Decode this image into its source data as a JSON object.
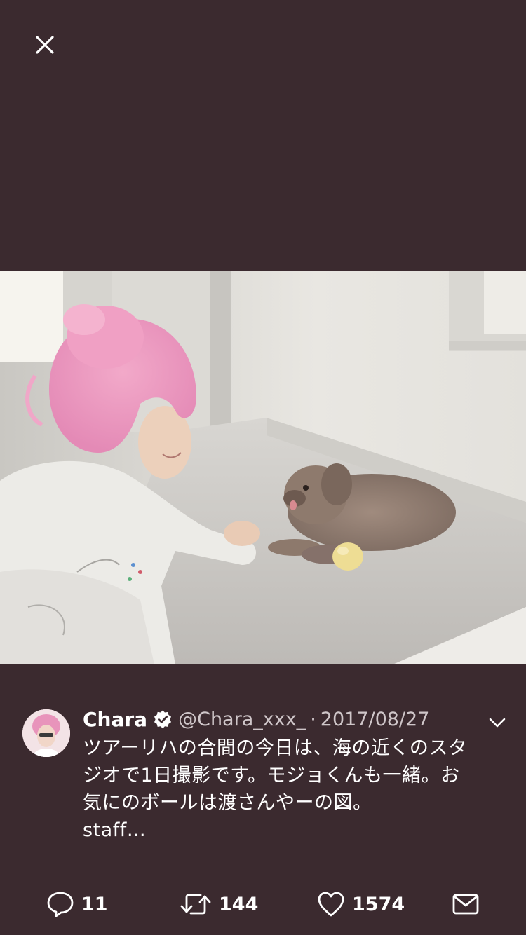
{
  "viewer": {
    "close_icon": "close-icon"
  },
  "tweet": {
    "display_name": "Chara",
    "handle": "@Chara_xxx_",
    "separator": "·",
    "date": "2017/08/27",
    "text_lines": [
      "ツアーリハの合間の今日は、海の近くのスタ",
      "ジオで1日撮影です。モジョくんも一緒。お",
      "気にのボールは渡さんやーの図。",
      "staff…"
    ],
    "verified_icon": "verified-badge-icon",
    "more_icon": "chevron-down-icon"
  },
  "actions": {
    "reply_count": "11",
    "retweet_count": "144",
    "like_count": "1574"
  },
  "colors": {
    "background": "#3b2a2f",
    "text": "#ffffff",
    "muted": "#cfc6c9"
  }
}
